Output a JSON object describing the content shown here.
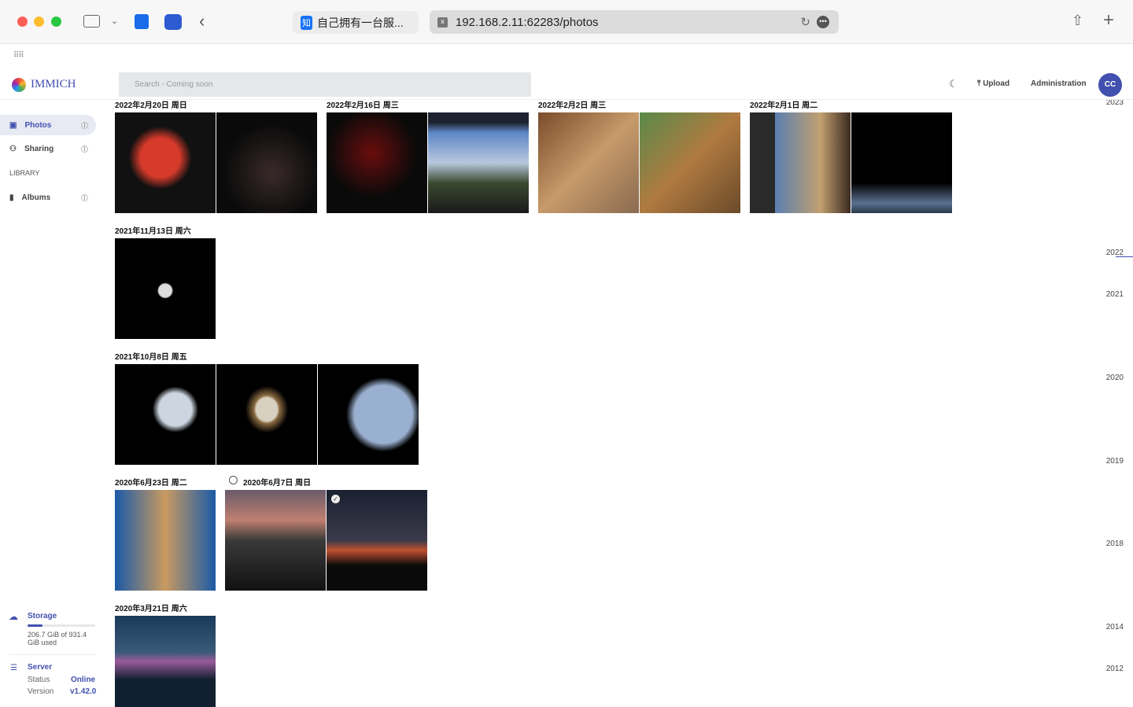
{
  "browser": {
    "tab_title": "自己拥有一台服...",
    "url": "192.168.2.11:62283/photos"
  },
  "app": {
    "logo": "IMMICH",
    "search_placeholder": "Search - Coming soon",
    "upload": "Upload",
    "administration": "Administration",
    "avatar": "CC"
  },
  "sidebar": {
    "photos": "Photos",
    "sharing": "Sharing",
    "library_heading": "LIBRARY",
    "albums": "Albums",
    "storage": {
      "label": "Storage",
      "used": "206.7 GiB of 931.4 GiB used",
      "fraction": 0.222
    },
    "server": {
      "label": "Server",
      "status_label": "Status",
      "status": "Online",
      "version_label": "Version",
      "version": "v1.42.0"
    }
  },
  "dates": [
    "2022年2月20日 周日",
    "2022年2月16日 周三",
    "2022年2月2日 周三",
    "2022年2月1日 周二",
    "2021年11月13日 周六",
    "2021年10月8日 周五",
    "2020年6月23日 周二",
    "2020年6月7日 周日",
    "2020年3月21日 周六"
  ],
  "timeline": [
    "2023",
    "2022",
    "2021",
    "2020",
    "2019",
    "2018",
    "2014",
    "2012"
  ],
  "colors": {
    "accent": "#4250af"
  }
}
